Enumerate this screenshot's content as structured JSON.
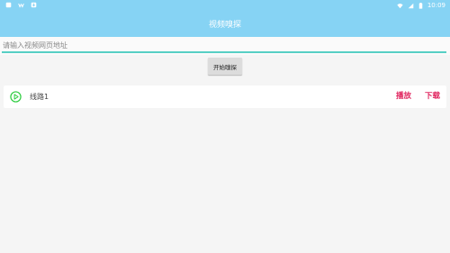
{
  "status_bar": {
    "time": "10:09",
    "left_icons": [
      "notification-icon",
      "wifi-app-icon",
      "download-status-icon"
    ],
    "right_icons": [
      "wifi-icon",
      "signal-icon",
      "battery-icon"
    ]
  },
  "app_bar": {
    "title": "视频嗅探"
  },
  "url_input": {
    "placeholder": "请输入视频网页地址",
    "value": ""
  },
  "start_button": {
    "label": "开始嗅探"
  },
  "routes": [
    {
      "label": "线路1",
      "play_label": "播放",
      "download_label": "下载"
    }
  ],
  "colors": {
    "header": "#86d3f4",
    "input_underline": "#57cfc5",
    "action": "#e0245e",
    "play_icon": "#2ecc40"
  }
}
